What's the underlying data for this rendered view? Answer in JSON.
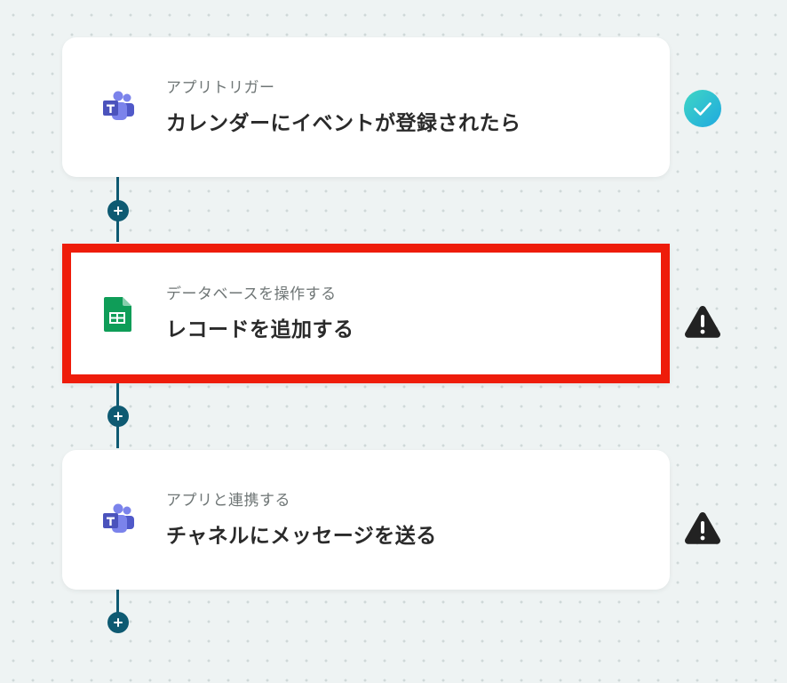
{
  "flow": {
    "steps": [
      {
        "app": "Microsoft Teams",
        "icon": "teams-icon",
        "category": "アプリトリガー",
        "title": "カレンダーにイベントが登録されたら",
        "status": "complete",
        "status_icon": "check-circle-icon"
      },
      {
        "app": "Google Sheets",
        "icon": "google-sheets-icon",
        "category": "データベースを操作する",
        "title": "レコードを追加する",
        "status": "warning",
        "status_icon": "warning-icon",
        "selected": true
      },
      {
        "app": "Microsoft Teams",
        "icon": "teams-icon",
        "category": "アプリと連携する",
        "title": "チャネルにメッセージを送る",
        "status": "warning",
        "status_icon": "warning-icon"
      }
    ]
  },
  "colors": {
    "background": "#eef3f3",
    "connector": "#0e5a72",
    "selection_border": "#ee1c0a",
    "check": "#22c3d6",
    "warning": "#222222",
    "teams": "#5059c9",
    "sheets": "#0f9d58"
  }
}
